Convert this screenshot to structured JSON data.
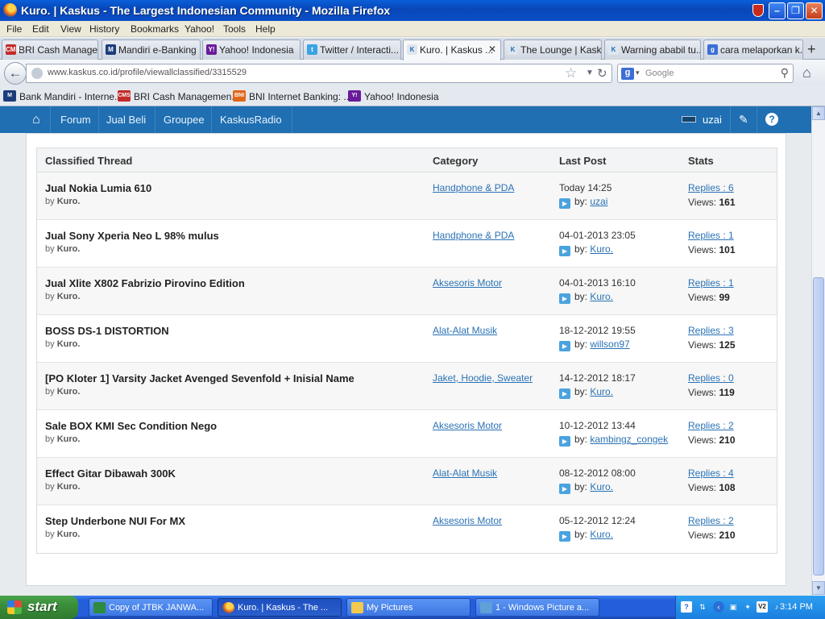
{
  "window": {
    "title": "Kuro. | Kaskus - The Largest Indonesian Community - Mozilla Firefox"
  },
  "menu": [
    "File",
    "Edit",
    "View",
    "History",
    "Bookmarks",
    "Yahoo!",
    "Tools",
    "Help"
  ],
  "tabs": [
    {
      "label": "BRI Cash Manage...",
      "icon": "CMS"
    },
    {
      "label": "Mandiri e-Banking ...",
      "icon": "M"
    },
    {
      "label": "Yahoo! Indonesia",
      "icon": "Y!"
    },
    {
      "label": "Twitter / Interacti...",
      "icon": "t"
    },
    {
      "label": "Kuro. | Kaskus ...",
      "icon": "K",
      "active": true
    },
    {
      "label": "The Lounge | Kask...",
      "icon": "K"
    },
    {
      "label": "Warning ababil tu...",
      "icon": "K"
    },
    {
      "label": "cara melaporkan k...",
      "icon": "g"
    }
  ],
  "address": {
    "url": "www.kaskus.co.id/profile/viewallclassified/3315529"
  },
  "search": {
    "engine": "g",
    "placeholder": "Google"
  },
  "bookmarks": [
    {
      "label": "Bank Mandiri - Interne...",
      "icon": "M"
    },
    {
      "label": "BRI Cash Managemen...",
      "icon": "CMS"
    },
    {
      "label": "BNI Internet Banking: ...",
      "icon": "BNI"
    },
    {
      "label": "Yahoo! Indonesia",
      "icon": "Y!"
    }
  ],
  "site_nav": {
    "items": [
      "Forum",
      "Jual Beli",
      "Groupee",
      "KaskusRadio"
    ],
    "user": "uzai"
  },
  "table": {
    "headers": {
      "thread": "Classified Thread",
      "category": "Category",
      "last_post": "Last Post",
      "stats": "Stats"
    },
    "by_label": "by",
    "by_prefix": "by:",
    "rows": [
      {
        "title": "Jual Nokia Lumia 610",
        "author": "Kuro.",
        "category": "Handphone & PDA",
        "date": "Today 14:25",
        "last_by": "uzai",
        "replies": "Replies : 6",
        "views_label": "Views:",
        "views": "161"
      },
      {
        "title": "Jual Sony Xperia Neo L 98% mulus",
        "author": "Kuro.",
        "category": "Handphone & PDA",
        "date": "04-01-2013 23:05",
        "last_by": "Kuro.",
        "replies": "Replies : 1",
        "views_label": "Views:",
        "views": "101"
      },
      {
        "title": "Jual Xlite X802 Fabrizio Pirovino Edition",
        "author": "Kuro.",
        "category": "Aksesoris Motor",
        "date": "04-01-2013 16:10",
        "last_by": "Kuro.",
        "replies": "Replies : 1",
        "views_label": "Views:",
        "views": "99"
      },
      {
        "title": "BOSS DS-1 DISTORTION",
        "author": "Kuro.",
        "category": "Alat-Alat Musik",
        "date": "18-12-2012 19:55",
        "last_by": "willson97",
        "replies": "Replies : 3",
        "views_label": "Views:",
        "views": "125"
      },
      {
        "title": "[PO Kloter 1] Varsity Jacket Avenged Sevenfold + Inisial Name",
        "author": "Kuro.",
        "category": "Jaket, Hoodie, Sweater",
        "date": "14-12-2012 18:17",
        "last_by": "Kuro.",
        "replies": "Replies : 0",
        "views_label": "Views:",
        "views": "119"
      },
      {
        "title": "Sale BOX KMI Sec Condition Nego",
        "author": "Kuro.",
        "category": "Aksesoris Motor",
        "date": "10-12-2012 13:44",
        "last_by": "kambingz_congek",
        "replies": "Replies : 2",
        "views_label": "Views:",
        "views": "210"
      },
      {
        "title": "Effect Gitar Dibawah 300K",
        "author": "Kuro.",
        "category": "Alat-Alat Musik",
        "date": "08-12-2012 08:00",
        "last_by": "Kuro.",
        "replies": "Replies : 4",
        "views_label": "Views:",
        "views": "108"
      },
      {
        "title": "Step Underbone NUI For MX",
        "author": "Kuro.",
        "category": "Aksesoris Motor",
        "date": "05-12-2012 12:24",
        "last_by": "Kuro.",
        "replies": "Replies : 2",
        "views_label": "Views:",
        "views": "210"
      }
    ]
  },
  "taskbar": {
    "start": "start",
    "items": [
      {
        "label": "Copy of JTBK JANWA...",
        "icon": "excel"
      },
      {
        "label": "Kuro. | Kaskus - The ...",
        "icon": "firefox",
        "active": true
      },
      {
        "label": "My Pictures",
        "icon": "folder"
      },
      {
        "label": "1 - Windows Picture a...",
        "icon": "picture"
      }
    ],
    "clock": "3:14 PM"
  },
  "colors": {
    "site_blue": "#1f6fb2",
    "link": "#2a72b5",
    "taskbar": "#245edb",
    "start_green": "#3a8e3a"
  }
}
